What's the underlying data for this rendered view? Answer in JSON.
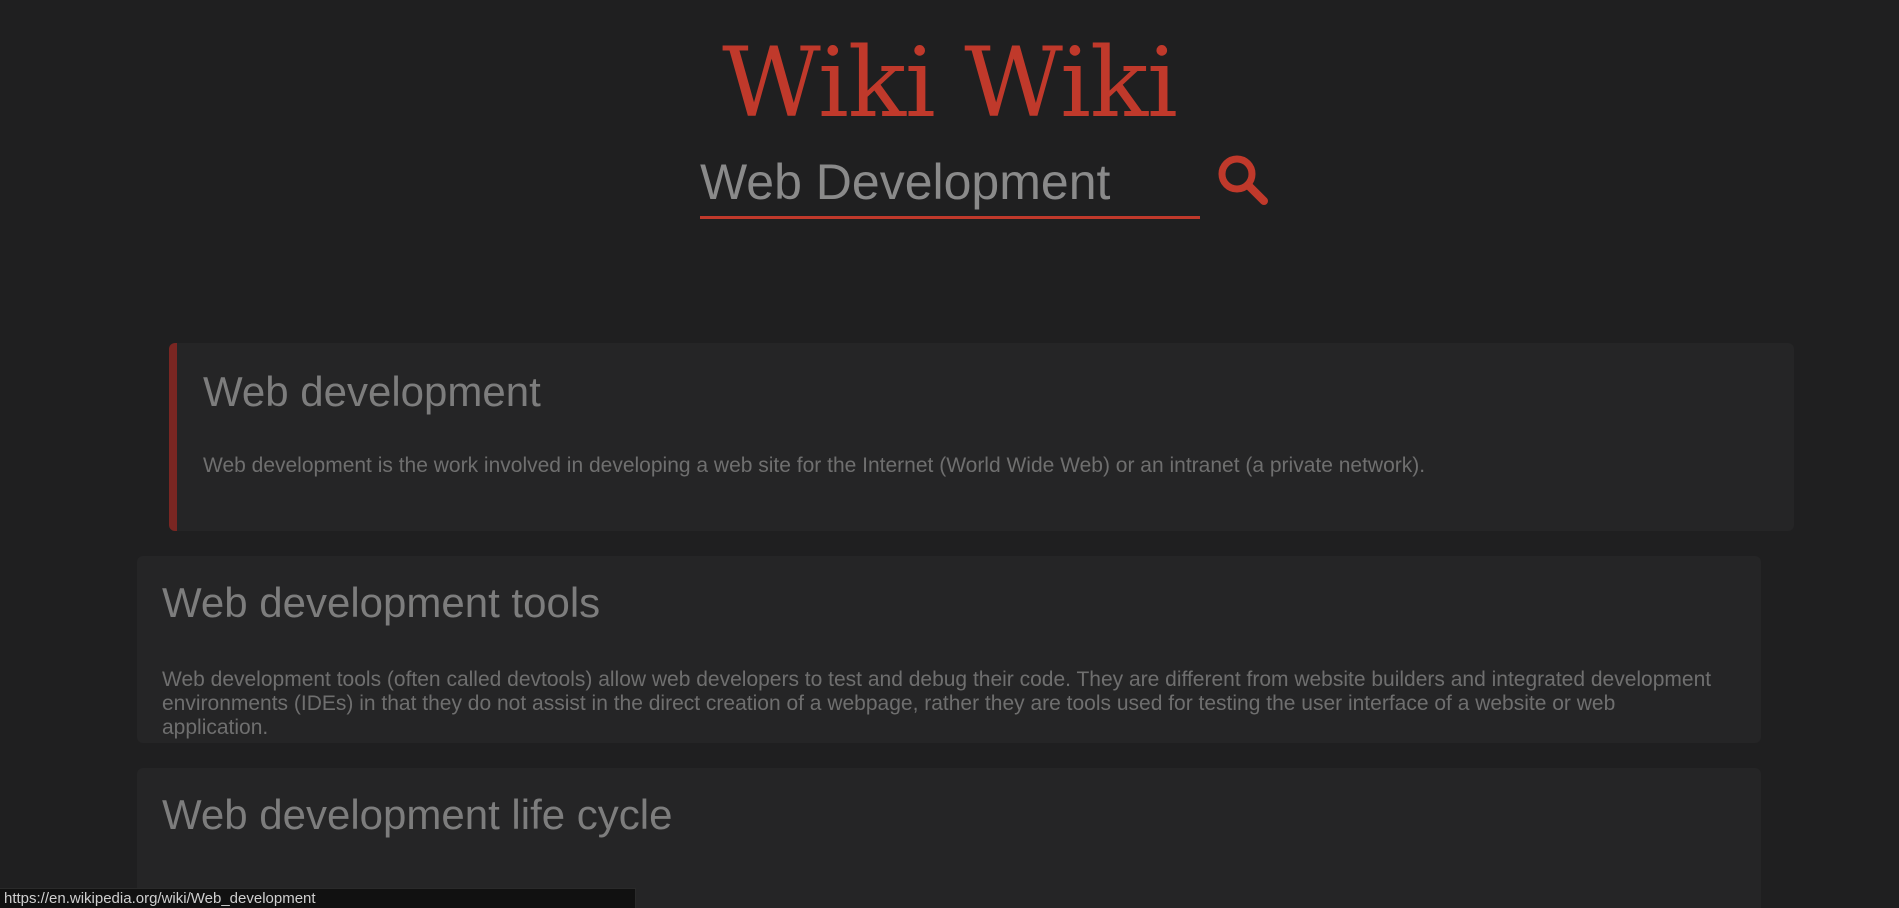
{
  "header": {
    "logo_text": "Wiki Wiki"
  },
  "search": {
    "value": "Web Development",
    "button_icon": "magnifier-icon"
  },
  "results": [
    {
      "title": "Web development",
      "snippet": "Web development is the work involved in developing a web site for the Internet (World Wide Web) or an intranet (a private network)."
    },
    {
      "title": "Web development tools",
      "snippet": "Web development tools (often called devtools) allow web developers to test and debug their code. They are different from website builders and integrated development environments (IDEs) in that they do not assist in the direct creation of a webpage, rather they are tools used for testing the user interface of a website or web application."
    },
    {
      "title": "Web development life cycle",
      "snippet": ""
    }
  ],
  "status_bar": {
    "url": "https://en.wikipedia.org/wiki/Web_development"
  },
  "colors": {
    "accent": "#c0392b",
    "background": "#1f1f20",
    "card": "#252526",
    "active_border": "#7a2622"
  }
}
